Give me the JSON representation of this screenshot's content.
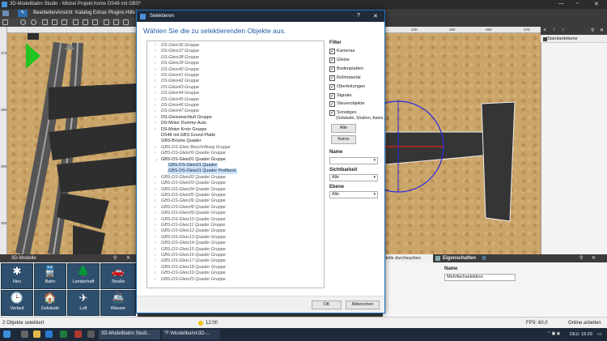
{
  "app": {
    "title": "3D-Modellbahn Studio - Michel Projekt home DS48 mit GBS*",
    "menu": [
      "Bearbeiten",
      "Ansicht",
      "Katalog",
      "Extras",
      "Plugins",
      "Hilfe"
    ]
  },
  "ruler": {
    "top_labels": [
      "440",
      "450",
      "460",
      "470"
    ],
    "left_labels": [
      "270",
      "280",
      "290",
      "300"
    ]
  },
  "right_panel": {
    "layer": "Standardebene"
  },
  "models_panel": {
    "title": "3D-Modelle",
    "tiles": [
      {
        "label": "Neu",
        "glyph": "✱"
      },
      {
        "label": "Bahn",
        "glyph": "🚆"
      },
      {
        "label": "Landschaft",
        "glyph": "🌲"
      },
      {
        "label": "Straße",
        "glyph": "🚗"
      },
      {
        "label": "Verlauf",
        "glyph": "🕒"
      },
      {
        "label": "Gebäude",
        "glyph": "🏠"
      },
      {
        "label": "Luft",
        "glyph": "✈"
      },
      {
        "label": "Wasser",
        "glyph": "🚢"
      }
    ]
  },
  "properties": {
    "search_placeholder": "delle durchsuchen",
    "title": "Eigenschaften",
    "name_label": "Name",
    "name_value": "Mehrfachselektion"
  },
  "statusbar": {
    "left": "2 Objekte selektiert",
    "time": "12:00",
    "fps": "FPS: 60,0",
    "online": "Online arbeiten"
  },
  "taskbar": {
    "apps": [
      "3D-Modellbahn Studi...",
      "\"F:\\Modellbahn\\3D-..."
    ],
    "lang": "DEU",
    "clock": "19:29"
  },
  "dialog": {
    "title": "Selektieren",
    "heading": "Wählen Sie die zu selektierenden Objekte aus.",
    "tree": [
      {
        "text": "DS-Gleis36 Gruppe",
        "italic": true
      },
      {
        "text": "DS-Gleis37 Gruppe",
        "italic": true
      },
      {
        "text": "DS-Gleis38 Gruppe",
        "italic": true
      },
      {
        "text": "DS-Gleis39 Gruppe",
        "italic": true
      },
      {
        "text": "DS-Gleis40 Gruppe",
        "italic": true
      },
      {
        "text": "DS-Gleis41 Gruppe",
        "italic": true
      },
      {
        "text": "DS-Gleis42 Gruppe",
        "italic": true
      },
      {
        "text": "DS-Gleis43 Gruppe",
        "italic": true
      },
      {
        "text": "DS-Gleis44 Gruppe",
        "italic": true
      },
      {
        "text": "DS-Gleis45 Gruppe",
        "italic": true
      },
      {
        "text": "DS-Gleis46 Gruppe",
        "italic": true
      },
      {
        "text": "DS-Gleis47 Gruppe",
        "italic": true
      },
      {
        "text": "DS-Gleisanschluß Gruppe",
        "italic": false
      },
      {
        "text": "DS-Motor Dummy-Auto",
        "italic": false
      },
      {
        "text": "DS-Motor Kreis Gruppe",
        "italic": false
      },
      {
        "text": "DS48 mit GBS Grund-Platte",
        "italic": false,
        "noarrow": true
      },
      {
        "text": "GBS-Brücke Quader",
        "italic": false,
        "noarrow": true
      },
      {
        "text": "GBS-DS-Gleis Beschriftung Gruppe",
        "italic": true
      },
      {
        "text": "GBS-DS-Gleis00 Quader Gruppe",
        "italic": true
      },
      {
        "text": "GBS-DS-Gleis01 Quader Gruppe",
        "italic": false,
        "expanded": true
      },
      {
        "text": "GBS-DS-Gleis01 Quader",
        "italic": false,
        "child": true,
        "selected": true
      },
      {
        "text": "GBS-DS-Gleis01 Quader Prellbock",
        "italic": false,
        "child": true,
        "selected": true
      },
      {
        "text": "GBS-DS-Gleis02 Quader Gruppe",
        "italic": true
      },
      {
        "text": "GBS-DS-Gleis03 Quader Gruppe",
        "italic": true
      },
      {
        "text": "GBS-DS-Gleis04 Quader Gruppe",
        "italic": true
      },
      {
        "text": "GBS-DS-Gleis05 Quader Gruppe",
        "italic": true
      },
      {
        "text": "GBS-DS-Gleis06 Quader Gruppe",
        "italic": true
      },
      {
        "text": "GBS-DS-Gleis08 Quader Gruppe",
        "italic": true
      },
      {
        "text": "GBS-DS-Gleis09 Quader Gruppe",
        "italic": true
      },
      {
        "text": "GBS-DS-Gleis10 Quader Gruppe",
        "italic": true
      },
      {
        "text": "GBS-DS-Gleis11 Quader Gruppe",
        "italic": true
      },
      {
        "text": "GBS-DS-Gleis12 Quader Gruppe",
        "italic": true
      },
      {
        "text": "GBS-DS-Gleis13 Quader Gruppe",
        "italic": true
      },
      {
        "text": "GBS-DS-Gleis14 Quader Gruppe",
        "italic": true
      },
      {
        "text": "GBS-DS-Gleis15 Quader Gruppe",
        "italic": true
      },
      {
        "text": "GBS-DS-Gleis16 Quader Gruppe",
        "italic": true
      },
      {
        "text": "GBS-DS-Gleis17 Quader Gruppe",
        "italic": true
      },
      {
        "text": "GBS-DS-Gleis18 Quader Gruppe",
        "italic": true
      },
      {
        "text": "GBS-DS-Gleis19 Quader Gruppe",
        "italic": true
      },
      {
        "text": "GBS-DS-Gleis20 Quader Gruppe",
        "italic": true
      }
    ],
    "filter": {
      "title": "Filter",
      "items": [
        {
          "label": "Kameras",
          "checked": true
        },
        {
          "label": "Gleise",
          "checked": true
        },
        {
          "label": "Bodenplatten",
          "checked": true
        },
        {
          "label": "Rollmaterial",
          "checked": true
        },
        {
          "label": "Oberleitungen",
          "checked": true
        },
        {
          "label": "Signale",
          "checked": true
        },
        {
          "label": "Steuerobjekte",
          "checked": true
        },
        {
          "label": "Sonstiges",
          "checked": true
        }
      ],
      "sonstiges_hint": "(Gebäude, Straßen, Autos…)",
      "all_button": "Alle",
      "none_button": "Keine"
    },
    "name_label": "Name",
    "name_value": "",
    "visibility_label": "Sichtbarkeit",
    "visibility_value": "Alle",
    "layer_label": "Ebene",
    "layer_value": "Alle",
    "ok": "OK",
    "cancel": "Abbrechen",
    "help_glyph": "?",
    "close_glyph": "✕"
  }
}
